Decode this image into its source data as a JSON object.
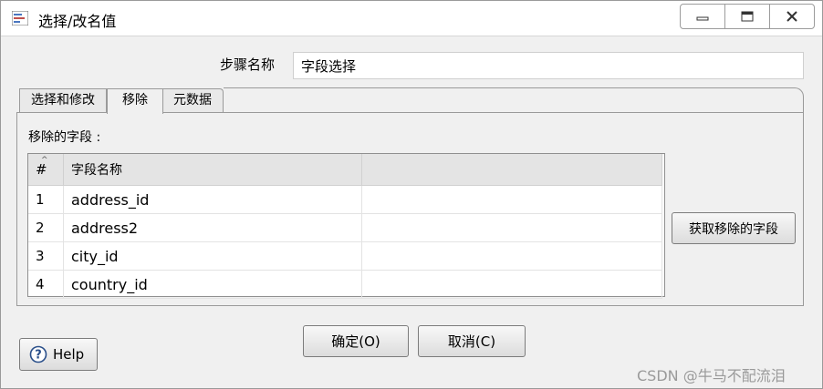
{
  "window": {
    "title": "选择/改名值"
  },
  "icons": {
    "app": "app-dialog-icon",
    "minimize": "minimize-icon",
    "maximize": "maximize-icon",
    "close": "close-icon",
    "help": "help-question-icon",
    "sort": "sort-caret-icon"
  },
  "step": {
    "label": "步骤名称",
    "value": "字段选择"
  },
  "tabs": [
    {
      "label": "选择和修改",
      "active": false
    },
    {
      "label": "移除",
      "active": true
    },
    {
      "label": "元数据",
      "active": false
    }
  ],
  "remove_section": {
    "label": "移除的字段 :",
    "columns": [
      "#",
      "字段名称",
      ""
    ],
    "rows": [
      {
        "num": "1",
        "field": "address_id"
      },
      {
        "num": "2",
        "field": "address2"
      },
      {
        "num": "3",
        "field": "city_id"
      },
      {
        "num": "4",
        "field": "country_id"
      }
    ],
    "get_button": "获取移除的字段"
  },
  "buttons": {
    "ok": "确定(O)",
    "cancel": "取消(C)",
    "help": "Help"
  },
  "watermark": "CSDN @牛马不配流泪"
}
